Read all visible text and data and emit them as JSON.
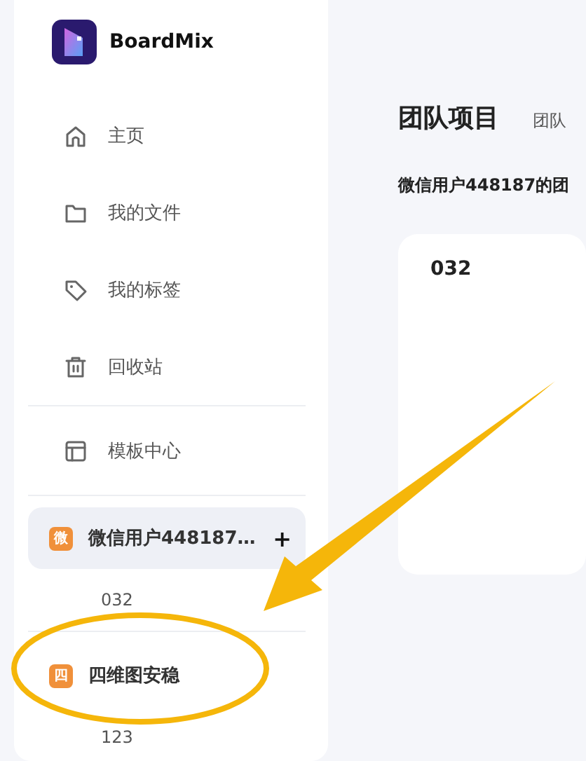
{
  "app": {
    "name": "BoardMix"
  },
  "nav": [
    {
      "label": "主页"
    },
    {
      "label": "我的文件"
    },
    {
      "label": "我的标签"
    },
    {
      "label": "回收站"
    }
  ],
  "templates": {
    "label": "模板中心"
  },
  "teams": [
    {
      "badge": "微",
      "name": "微信用户448187…",
      "selected": true,
      "add": "+",
      "children": [
        {
          "label": "032"
        }
      ]
    },
    {
      "badge": "四",
      "name": "四维图安稳",
      "selected": false,
      "children": [
        {
          "label": "123"
        }
      ]
    }
  ],
  "main": {
    "title": "团队项目",
    "tab": "团队",
    "subtitle": "微信用户448187的团",
    "cards": [
      {
        "title": "032"
      }
    ]
  }
}
